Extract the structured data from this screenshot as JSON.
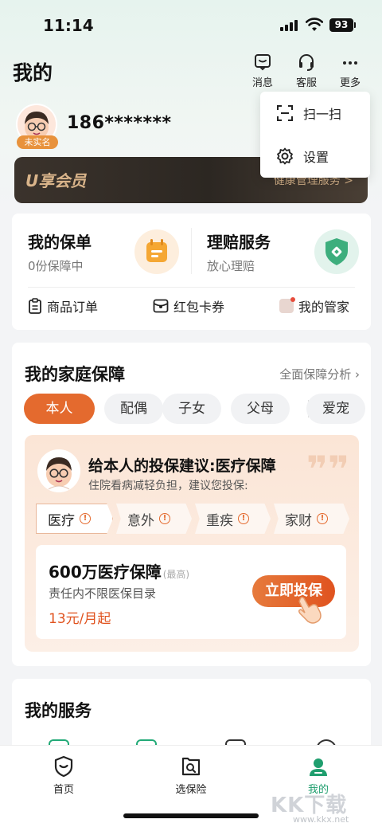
{
  "status_bar": {
    "time": "11:14",
    "battery": "93"
  },
  "header": {
    "title": "我的",
    "actions": [
      {
        "label": "消息",
        "icon": "message-icon"
      },
      {
        "label": "客服",
        "icon": "headset-icon"
      },
      {
        "label": "更多",
        "icon": "more-icon"
      }
    ]
  },
  "more_menu": {
    "items": [
      {
        "label": "扫一扫",
        "icon": "scan-icon"
      },
      {
        "label": "设置",
        "icon": "gear-icon"
      }
    ]
  },
  "user": {
    "phone": "186*******",
    "verify_badge": "未实名"
  },
  "vip": {
    "logo": "U享会员",
    "service": "健康管理服务 >"
  },
  "entries": {
    "policy": {
      "title": "我的保单",
      "sub": "0份保障中"
    },
    "claims": {
      "title": "理赔服务",
      "sub": "放心理赔"
    },
    "orders": "商品订单",
    "coupons": "红包卡券",
    "butler": "我的管家"
  },
  "family": {
    "title": "我的家庭保障",
    "link": "全面保障分析",
    "members": [
      "本人",
      "配偶",
      "子女",
      "父母",
      "爱宠"
    ],
    "active_member": "本人",
    "advice": {
      "title": "给本人的投保建议:医疗保障",
      "sub": "住院看病减轻负担，建议您投保:",
      "categories": [
        "医疗",
        "意外",
        "重疾",
        "家财"
      ],
      "active_category": "医疗",
      "product": {
        "name": "600万医疗保障",
        "tag": "(最高)",
        "desc": "责任内不限医保目录",
        "price": "13元/月起",
        "cta": "立即投保"
      }
    }
  },
  "services": {
    "title": "我的服务"
  },
  "tabbar": {
    "items": [
      {
        "label": "首页",
        "icon": "home-shield-icon"
      },
      {
        "label": "选保险",
        "icon": "search-insurance-icon"
      },
      {
        "label": "我的",
        "icon": "profile-icon"
      }
    ],
    "active": "我的"
  },
  "watermark": {
    "text": "KK下载",
    "url": "www.kkx.net"
  },
  "colors": {
    "accent": "#e46a2e",
    "brand_green": "#1f9e6e",
    "price": "#e0531f"
  }
}
